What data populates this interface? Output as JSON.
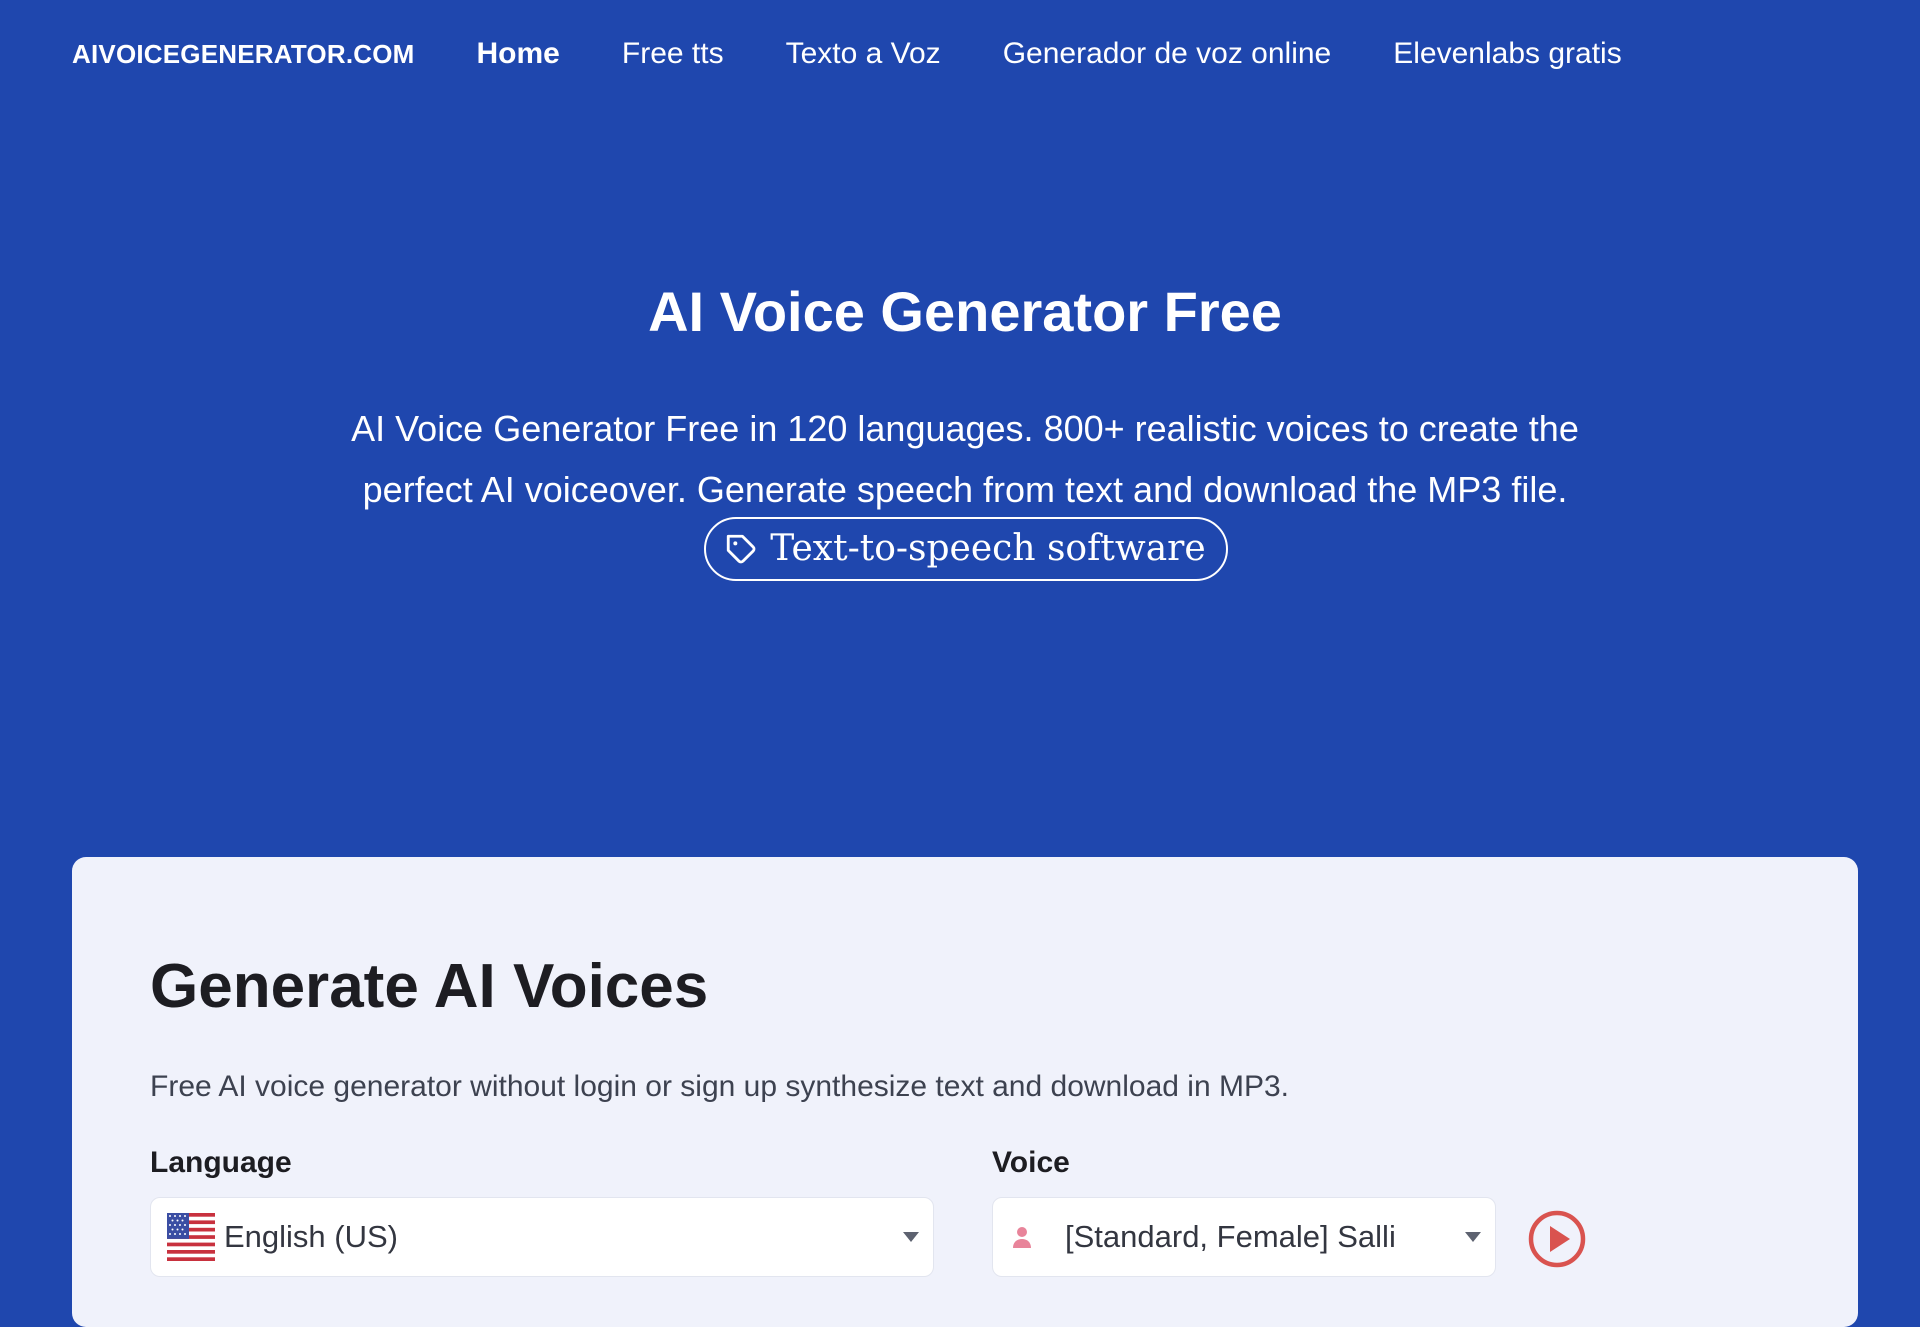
{
  "nav": {
    "brand": "AIVOICEGENERATOR.COM",
    "links": [
      {
        "label": "Home",
        "active": true
      },
      {
        "label": "Free tts",
        "active": false
      },
      {
        "label": "Texto a Voz",
        "active": false
      },
      {
        "label": "Generador de voz online",
        "active": false
      },
      {
        "label": "Elevenlabs gratis",
        "active": false
      }
    ]
  },
  "hero": {
    "title": "AI Voice Generator Free",
    "description": "AI Voice Generator Free in 120 languages. 800+ realistic voices to create the perfect AI voiceover. Generate speech from text and download the MP3 file.",
    "tag": {
      "label": "Text-to-speech software",
      "icon": "tag-icon"
    }
  },
  "generator": {
    "title": "Generate AI Voices",
    "description": "Free AI voice generator without login or sign up synthesize text and download in MP3.",
    "language": {
      "label": "Language",
      "value": "English (US)",
      "icon": "us-flag-icon"
    },
    "voice": {
      "label": "Voice",
      "value": "[Standard, Female] Salli",
      "icon": "female-person-icon"
    },
    "play_icon": "play-circle-icon"
  },
  "colors": {
    "background": "#1f47ae",
    "card": "#f0f2fb",
    "play": "#d9534f",
    "person": "#e8849a"
  }
}
